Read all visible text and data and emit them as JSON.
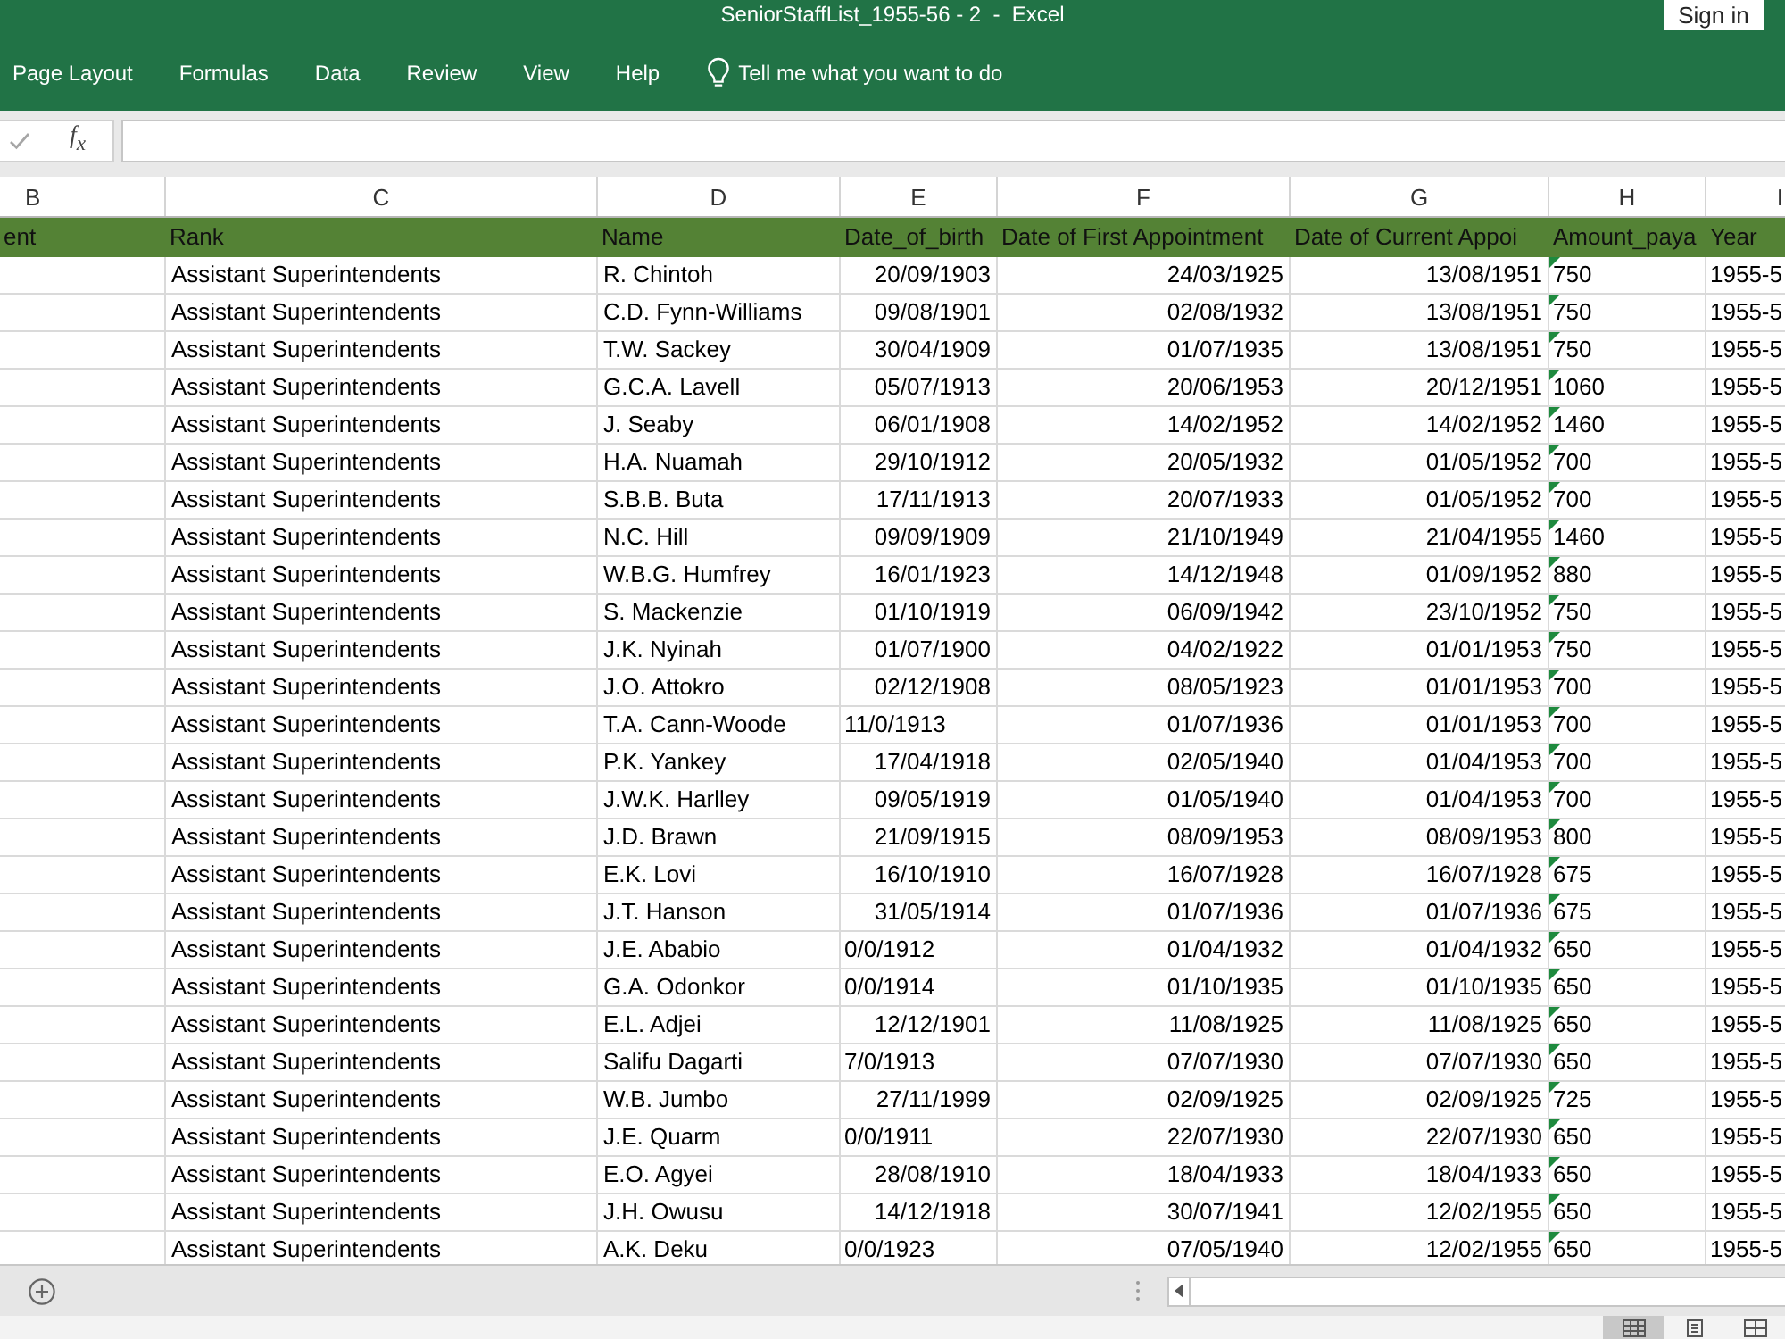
{
  "title_bar": {
    "title": "SeniorStaffList_1955-56 - 2  -  Excel",
    "sign_in": "Sign in"
  },
  "ribbon": {
    "tabs": [
      "Page Layout",
      "Formulas",
      "Data",
      "Review",
      "View",
      "Help"
    ],
    "tell_me": "Tell me what you want to do"
  },
  "formula_bar": {
    "insert_function": "f$_{x}$"
  },
  "sheet": {
    "columns": [
      {
        "letter": "B",
        "heading": "ent"
      },
      {
        "letter": "C",
        "heading": "Rank"
      },
      {
        "letter": "D",
        "heading": "Name"
      },
      {
        "letter": "E",
        "heading": "Date_of_birth"
      },
      {
        "letter": "F",
        "heading": "Date of First Appointment"
      },
      {
        "letter": "G",
        "heading": "Date of Current Appoi"
      },
      {
        "letter": "H",
        "heading": "Amount_paya"
      },
      {
        "letter": "I",
        "heading": "Year"
      }
    ],
    "rows": [
      {
        "rank": "Assistant Superintendents",
        "name": "R. Chintoh",
        "date_of_birth": "20/09/1903",
        "dob_left_aligned": false,
        "first_appointment": "24/03/1925",
        "current_appointment": "13/08/1951",
        "amount": "750",
        "amount_flagged": true,
        "year": "1955-5"
      },
      {
        "rank": "Assistant Superintendents",
        "name": "C.D. Fynn-Williams",
        "date_of_birth": "09/08/1901",
        "dob_left_aligned": false,
        "first_appointment": "02/08/1932",
        "current_appointment": "13/08/1951",
        "amount": "750",
        "amount_flagged": true,
        "year": "1955-5"
      },
      {
        "rank": "Assistant Superintendents",
        "name": "T.W. Sackey",
        "date_of_birth": "30/04/1909",
        "dob_left_aligned": false,
        "first_appointment": "01/07/1935",
        "current_appointment": "13/08/1951",
        "amount": "750",
        "amount_flagged": true,
        "year": "1955-5"
      },
      {
        "rank": "Assistant Superintendents",
        "name": "G.C.A. Lavell",
        "date_of_birth": "05/07/1913",
        "dob_left_aligned": false,
        "first_appointment": "20/06/1953",
        "current_appointment": "20/12/1951",
        "amount": "1060",
        "amount_flagged": true,
        "year": "1955-5"
      },
      {
        "rank": "Assistant Superintendents",
        "name": "J. Seaby",
        "date_of_birth": "06/01/1908",
        "dob_left_aligned": false,
        "first_appointment": "14/02/1952",
        "current_appointment": "14/02/1952",
        "amount": "1460",
        "amount_flagged": true,
        "year": "1955-5"
      },
      {
        "rank": "Assistant Superintendents",
        "name": "H.A. Nuamah",
        "date_of_birth": "29/10/1912",
        "dob_left_aligned": false,
        "first_appointment": "20/05/1932",
        "current_appointment": "01/05/1952",
        "amount": "700",
        "amount_flagged": true,
        "year": "1955-5"
      },
      {
        "rank": "Assistant Superintendents",
        "name": "S.B.B. Buta",
        "date_of_birth": "17/11/1913",
        "dob_left_aligned": false,
        "first_appointment": "20/07/1933",
        "current_appointment": "01/05/1952",
        "amount": "700",
        "amount_flagged": true,
        "year": "1955-5"
      },
      {
        "rank": "Assistant Superintendents",
        "name": "N.C. Hill",
        "date_of_birth": "09/09/1909",
        "dob_left_aligned": false,
        "first_appointment": "21/10/1949",
        "current_appointment": "21/04/1955",
        "amount": "1460",
        "amount_flagged": true,
        "year": "1955-5"
      },
      {
        "rank": "Assistant Superintendents",
        "name": "W.B.G. Humfrey",
        "date_of_birth": "16/01/1923",
        "dob_left_aligned": false,
        "first_appointment": "14/12/1948",
        "current_appointment": "01/09/1952",
        "amount": "880",
        "amount_flagged": true,
        "year": "1955-5"
      },
      {
        "rank": "Assistant Superintendents",
        "name": "S. Mackenzie",
        "date_of_birth": "01/10/1919",
        "dob_left_aligned": false,
        "first_appointment": "06/09/1942",
        "current_appointment": "23/10/1952",
        "amount": "750",
        "amount_flagged": true,
        "year": "1955-5"
      },
      {
        "rank": "Assistant Superintendents",
        "name": "J.K. Nyinah",
        "date_of_birth": "01/07/1900",
        "dob_left_aligned": false,
        "first_appointment": "04/02/1922",
        "current_appointment": "01/01/1953",
        "amount": "750",
        "amount_flagged": true,
        "year": "1955-5"
      },
      {
        "rank": "Assistant Superintendents",
        "name": "J.O. Attokro",
        "date_of_birth": "02/12/1908",
        "dob_left_aligned": false,
        "first_appointment": "08/05/1923",
        "current_appointment": "01/01/1953",
        "amount": "700",
        "amount_flagged": true,
        "year": "1955-5"
      },
      {
        "rank": "Assistant Superintendents",
        "name": "T.A. Cann-Woode",
        "date_of_birth": "11/0/1913",
        "dob_left_aligned": true,
        "first_appointment": "01/07/1936",
        "current_appointment": "01/01/1953",
        "amount": "700",
        "amount_flagged": true,
        "year": "1955-5"
      },
      {
        "rank": "Assistant Superintendents",
        "name": "P.K. Yankey",
        "date_of_birth": "17/04/1918",
        "dob_left_aligned": false,
        "first_appointment": "02/05/1940",
        "current_appointment": "01/04/1953",
        "amount": "700",
        "amount_flagged": true,
        "year": "1955-5"
      },
      {
        "rank": "Assistant Superintendents",
        "name": "J.W.K. Harlley",
        "date_of_birth": "09/05/1919",
        "dob_left_aligned": false,
        "first_appointment": "01/05/1940",
        "current_appointment": "01/04/1953",
        "amount": "700",
        "amount_flagged": true,
        "year": "1955-5"
      },
      {
        "rank": "Assistant Superintendents",
        "name": "J.D. Brawn",
        "date_of_birth": "21/09/1915",
        "dob_left_aligned": false,
        "first_appointment": "08/09/1953",
        "current_appointment": "08/09/1953",
        "amount": "800",
        "amount_flagged": true,
        "year": "1955-5"
      },
      {
        "rank": "Assistant Superintendents",
        "name": "E.K. Lovi",
        "date_of_birth": "16/10/1910",
        "dob_left_aligned": false,
        "first_appointment": "16/07/1928",
        "current_appointment": "16/07/1928",
        "amount": "675",
        "amount_flagged": true,
        "year": "1955-5"
      },
      {
        "rank": "Assistant Superintendents",
        "name": "J.T. Hanson",
        "date_of_birth": "31/05/1914",
        "dob_left_aligned": false,
        "first_appointment": "01/07/1936",
        "current_appointment": "01/07/1936",
        "amount": "675",
        "amount_flagged": true,
        "year": "1955-5"
      },
      {
        "rank": "Assistant Superintendents",
        "name": "J.E. Ababio",
        "date_of_birth": "0/0/1912",
        "dob_left_aligned": true,
        "first_appointment": "01/04/1932",
        "current_appointment": "01/04/1932",
        "amount": "650",
        "amount_flagged": true,
        "year": "1955-5"
      },
      {
        "rank": "Assistant Superintendents",
        "name": "G.A. Odonkor",
        "date_of_birth": "0/0/1914",
        "dob_left_aligned": true,
        "first_appointment": "01/10/1935",
        "current_appointment": "01/10/1935",
        "amount": "650",
        "amount_flagged": true,
        "year": "1955-5"
      },
      {
        "rank": "Assistant Superintendents",
        "name": "E.L. Adjei",
        "date_of_birth": "12/12/1901",
        "dob_left_aligned": false,
        "first_appointment": "11/08/1925",
        "current_appointment": "11/08/1925",
        "amount": "650",
        "amount_flagged": true,
        "year": "1955-5"
      },
      {
        "rank": "Assistant Superintendents",
        "name": "Salifu Dagarti",
        "date_of_birth": "7/0/1913",
        "dob_left_aligned": true,
        "first_appointment": "07/07/1930",
        "current_appointment": "07/07/1930",
        "amount": "650",
        "amount_flagged": true,
        "year": "1955-5"
      },
      {
        "rank": "Assistant Superintendents",
        "name": "W.B. Jumbo",
        "date_of_birth": "27/11/1999",
        "dob_left_aligned": false,
        "first_appointment": "02/09/1925",
        "current_appointment": "02/09/1925",
        "amount": "725",
        "amount_flagged": true,
        "year": "1955-5"
      },
      {
        "rank": "Assistant Superintendents",
        "name": "J.E. Quarm",
        "date_of_birth": "0/0/1911",
        "dob_left_aligned": true,
        "first_appointment": "22/07/1930",
        "current_appointment": "22/07/1930",
        "amount": "650",
        "amount_flagged": true,
        "year": "1955-5"
      },
      {
        "rank": "Assistant Superintendents",
        "name": "E.O. Agyei",
        "date_of_birth": "28/08/1910",
        "dob_left_aligned": false,
        "first_appointment": "18/04/1933",
        "current_appointment": "18/04/1933",
        "amount": "650",
        "amount_flagged": true,
        "year": "1955-5"
      },
      {
        "rank": "Assistant Superintendents",
        "name": "J.H. Owusu",
        "date_of_birth": "14/12/1918",
        "dob_left_aligned": false,
        "first_appointment": "30/07/1941",
        "current_appointment": "12/02/1955",
        "amount": "650",
        "amount_flagged": true,
        "year": "1955-5"
      },
      {
        "rank": "Assistant Superintendents",
        "name": "A.K. Deku",
        "date_of_birth": "0/0/1923",
        "dob_left_aligned": true,
        "first_appointment": "07/05/1940",
        "current_appointment": "12/02/1955",
        "amount": "650",
        "amount_flagged": true,
        "year": "1955-5"
      }
    ]
  },
  "status_bar": {
    "view_buttons": [
      {
        "kind": "normal",
        "selected": true
      },
      {
        "kind": "page_layout",
        "selected": false
      },
      {
        "kind": "page_break",
        "selected": false
      }
    ]
  }
}
